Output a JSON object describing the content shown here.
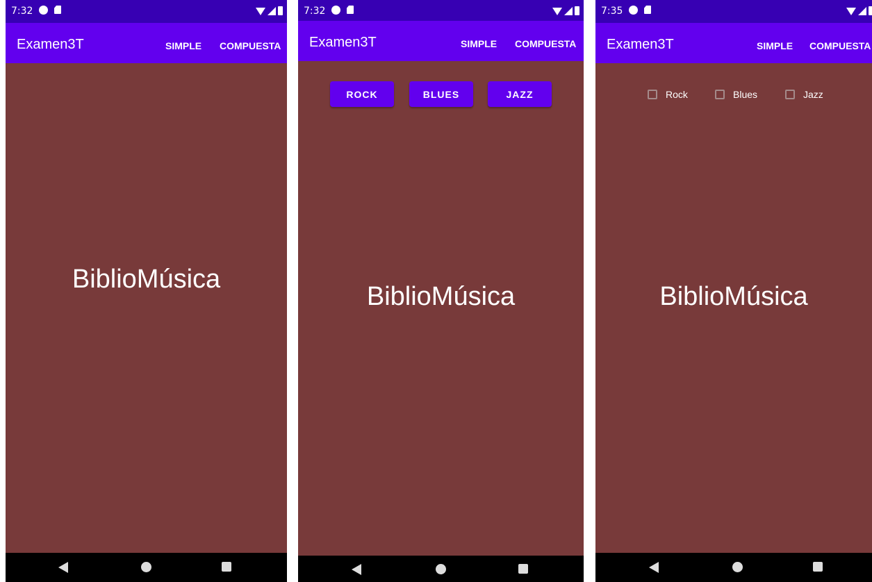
{
  "colors": {
    "status_bar": "#3700b3",
    "app_bar": "#6200ee",
    "background": "#783a3a",
    "nav_bar": "#000000",
    "text": "#ffffff"
  },
  "screens": [
    {
      "status": {
        "time": "7:32"
      },
      "app_bar": {
        "title": "Examen3T",
        "actions": [
          "SIMPLE",
          "COMPUESTA"
        ]
      },
      "main": {
        "heading": "BiblioMúsica"
      }
    },
    {
      "status": {
        "time": "7:32"
      },
      "app_bar": {
        "title": "Examen3T",
        "actions": [
          "SIMPLE",
          "COMPUESTA"
        ]
      },
      "main": {
        "buttons": [
          "ROCK",
          "BLUES",
          "JAZZ"
        ],
        "heading": "BiblioMúsica"
      }
    },
    {
      "status": {
        "time": "7:35"
      },
      "app_bar": {
        "title": "Examen3T",
        "actions": [
          "SIMPLE",
          "COMPUESTA"
        ]
      },
      "main": {
        "checkboxes": [
          "Rock",
          "Blues",
          "Jazz"
        ],
        "heading": "BiblioMúsica"
      }
    }
  ],
  "icons": {
    "status_left": [
      "notification-circle-icon",
      "sd-card-icon"
    ],
    "status_right": [
      "wifi-icon",
      "signal-icon",
      "battery-icon"
    ],
    "nav": [
      "back-icon",
      "home-icon",
      "recent-apps-icon"
    ]
  }
}
